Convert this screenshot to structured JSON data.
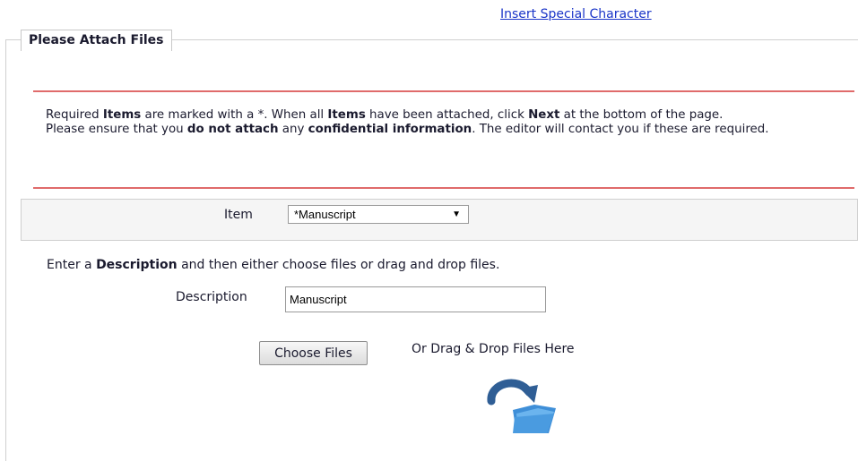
{
  "header": {
    "insert_special_character": "Insert Special Character"
  },
  "section": {
    "legend": "Please Attach Files"
  },
  "notice": {
    "line1_a": "Required ",
    "line1_b": "Items",
    "line1_c": " are marked with a *. When all ",
    "line1_d": "Items",
    "line1_e": " have been attached, click ",
    "line1_f": "Next",
    "line1_g": " at the bottom of the page.",
    "line2_a": "Please ensure that you ",
    "line2_b": "do not attach",
    "line2_c": " any ",
    "line2_d": "confidential information",
    "line2_e": ". The editor will contact you if these are required."
  },
  "item": {
    "label": "Item",
    "selected": "*Manuscript"
  },
  "instruction": {
    "a": "Enter a ",
    "b": "Description",
    "c": " and then either choose files or drag and drop files."
  },
  "description": {
    "label": "Description",
    "value": "Manuscript"
  },
  "upload": {
    "choose_files_label": "Choose Files",
    "drag_drop_text": "Or Drag & Drop Files Here",
    "drop_icon": "folder-drop-icon"
  },
  "colors": {
    "link": "#1a35c8",
    "notice_border": "#e06b6b",
    "icon_arrow": "#2f5e95",
    "icon_folder": "#4a9be0"
  }
}
